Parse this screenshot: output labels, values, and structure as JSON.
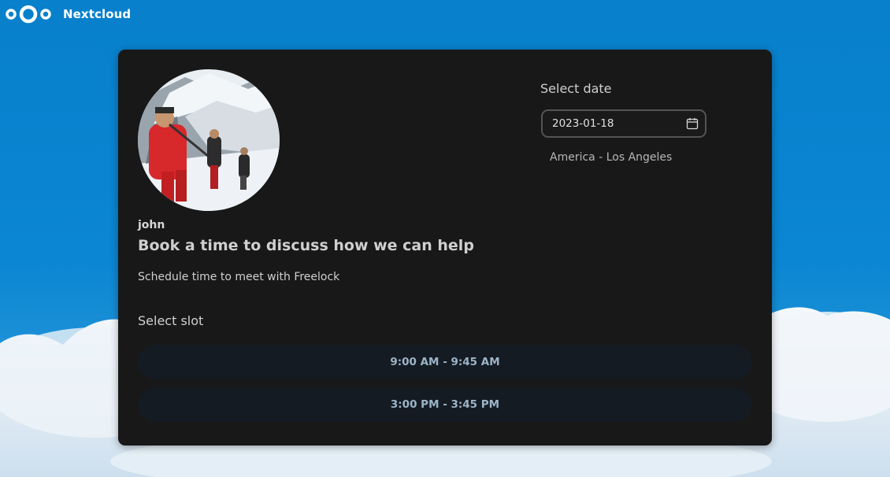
{
  "header": {
    "brand": "Nextcloud",
    "logo_icon": "nextcloud-logo-icon"
  },
  "profile": {
    "username": "john",
    "avatar": "user-avatar-photo"
  },
  "booking": {
    "title": "Book a time to discuss how we can help",
    "description": "Schedule time to meet with Freelock",
    "slot_label": "Select slot",
    "slots": [
      "9:00 AM - 9:45 AM",
      "3:00 PM - 3:45 PM"
    ]
  },
  "date_picker": {
    "label": "Select date",
    "value": "2023-01-18",
    "timezone": "America - Los Angeles",
    "icon": "calendar-icon"
  },
  "colors": {
    "background_blue": "#0a7fc8",
    "card": "#181818",
    "slot_bg": "#151b22",
    "slot_text": "#9bb4c8"
  }
}
